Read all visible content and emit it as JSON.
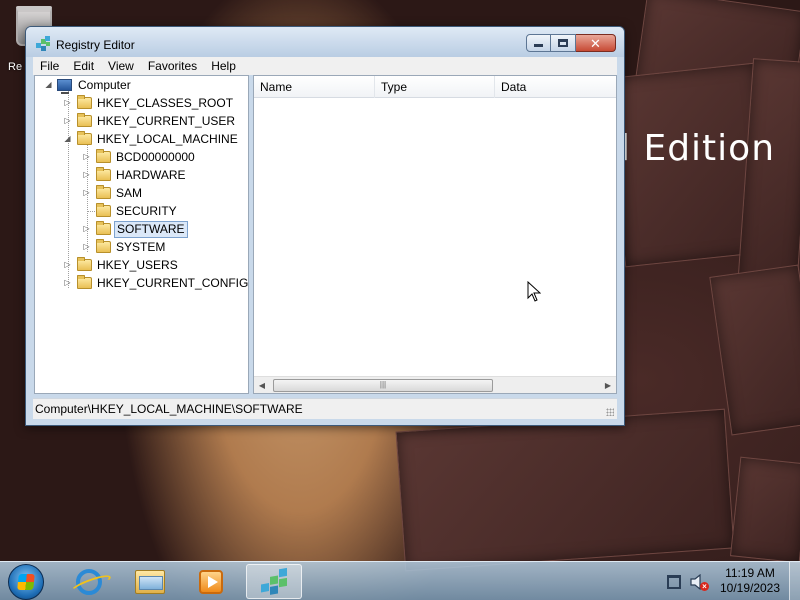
{
  "desktop": {
    "recycle_bin_label": "Re",
    "background_text": "l Edition"
  },
  "window": {
    "title": "Registry Editor",
    "app_icon": "registry-editor-icon",
    "controls": [
      "minimize",
      "maximize",
      "close"
    ]
  },
  "menu": {
    "items": [
      "File",
      "Edit",
      "View",
      "Favorites",
      "Help"
    ]
  },
  "tree": {
    "root": "Computer",
    "hives": {
      "classes_root": "HKEY_CLASSES_ROOT",
      "current_user": "HKEY_CURRENT_USER",
      "local_machine": "HKEY_LOCAL_MACHINE",
      "users": "HKEY_USERS",
      "current_config": "HKEY_CURRENT_CONFIG"
    },
    "local_machine_children": [
      "BCD00000000",
      "HARDWARE",
      "SAM",
      "SECURITY",
      "SOFTWARE",
      "SYSTEM"
    ],
    "selected": "SOFTWARE"
  },
  "list": {
    "columns": [
      "Name",
      "Type",
      "Data"
    ]
  },
  "statusbar": {
    "path": "Computer\\HKEY_LOCAL_MACHINE\\SOFTWARE"
  },
  "taskbar": {
    "pinned": [
      "internet-explorer-icon",
      "windows-explorer-icon",
      "media-player-icon",
      "registry-editor-icon"
    ],
    "active": "registry-editor-icon",
    "clock_time": "11:19 AM",
    "clock_date": "10/19/2023",
    "volume_state": "muted"
  },
  "colors": {
    "selection_bg": "#dbe8f8",
    "selection_border": "#7da2ce",
    "close_button": "#c74a34"
  }
}
